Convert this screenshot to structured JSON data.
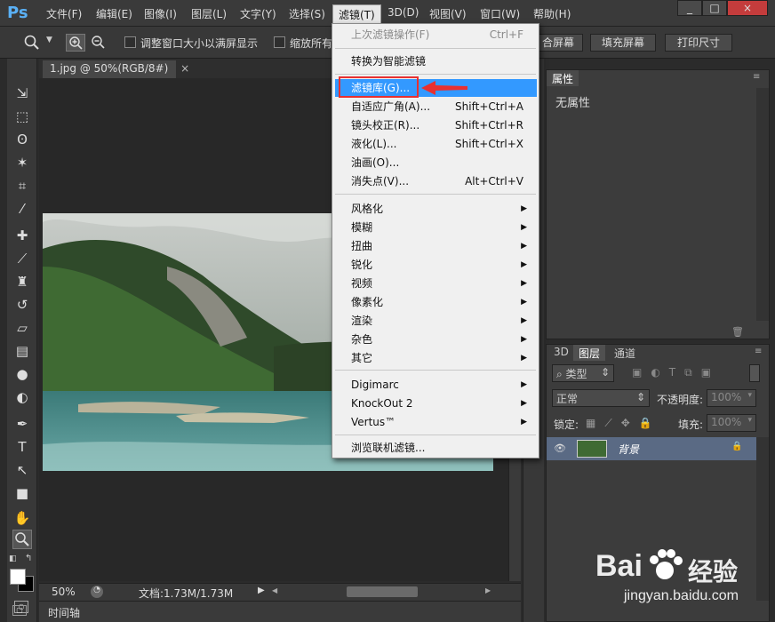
{
  "app": {
    "logo": "Ps"
  },
  "menubar": {
    "items": [
      "文件(F)",
      "编辑(E)",
      "图像(I)",
      "图层(L)",
      "文字(Y)",
      "选择(S)",
      "滤镜(T)",
      "3D(D)",
      "视图(V)",
      "窗口(W)",
      "帮助(H)"
    ],
    "active_index": 6,
    "window_controls": [
      "_",
      "□",
      "×"
    ]
  },
  "options_bar": {
    "checkbox1_label": "调整窗口大小以满屏显示",
    "checkbox2_label": "缩放所有",
    "fit_screen": "合屏幕",
    "fill_screen": "填充屏幕",
    "print_size": "打印尺寸"
  },
  "document": {
    "tab_title": "1.jpg @ 50%(RGB/8#)",
    "tab_close": "×",
    "zoom": "50%",
    "doc_info": "文档:1.73M/1.73M",
    "timeline_label": "时间轴"
  },
  "filter_menu": {
    "items": [
      {
        "label": "上次滤镜操作(F)",
        "shortcut": "Ctrl+F",
        "disabled": true
      },
      {
        "label": "转换为智能滤镜",
        "shortcut": ""
      },
      {
        "label": "滤镜库(G)...",
        "shortcut": "",
        "highlight": true
      },
      {
        "label": "自适应广角(A)...",
        "shortcut": "Shift+Ctrl+A"
      },
      {
        "label": "镜头校正(R)...",
        "shortcut": "Shift+Ctrl+R"
      },
      {
        "label": "液化(L)...",
        "shortcut": "Shift+Ctrl+X"
      },
      {
        "label": "油画(O)...",
        "shortcut": ""
      },
      {
        "label": "消失点(V)...",
        "shortcut": "Alt+Ctrl+V"
      },
      {
        "label": "风格化",
        "submenu": true
      },
      {
        "label": "模糊",
        "submenu": true
      },
      {
        "label": "扭曲",
        "submenu": true
      },
      {
        "label": "锐化",
        "submenu": true
      },
      {
        "label": "视频",
        "submenu": true
      },
      {
        "label": "像素化",
        "submenu": true
      },
      {
        "label": "渲染",
        "submenu": true
      },
      {
        "label": "杂色",
        "submenu": true
      },
      {
        "label": "其它",
        "submenu": true
      },
      {
        "label": "Digimarc",
        "submenu": true
      },
      {
        "label": "KnockOut 2",
        "submenu": true
      },
      {
        "label": "Vertus™",
        "submenu": true
      },
      {
        "label": "浏览联机滤镜..."
      }
    ]
  },
  "properties_panel": {
    "tab": "属性",
    "content": "无属性"
  },
  "layers_panel": {
    "tabs": [
      "3D",
      "图层",
      "通道"
    ],
    "active_tab": 1,
    "filter_type": "类型",
    "blend_mode": "正常",
    "opacity_label": "不透明度:",
    "opacity_value": "100%",
    "lock_label": "锁定:",
    "fill_label": "填充:",
    "fill_value": "100%",
    "layer_name": "背景"
  },
  "watermark": {
    "brand": "Bai",
    "brand2": "经验",
    "url": "jingyan.baidu.com"
  },
  "colors": {
    "accent": "#3399ff",
    "highlight_box": "#e83030"
  }
}
